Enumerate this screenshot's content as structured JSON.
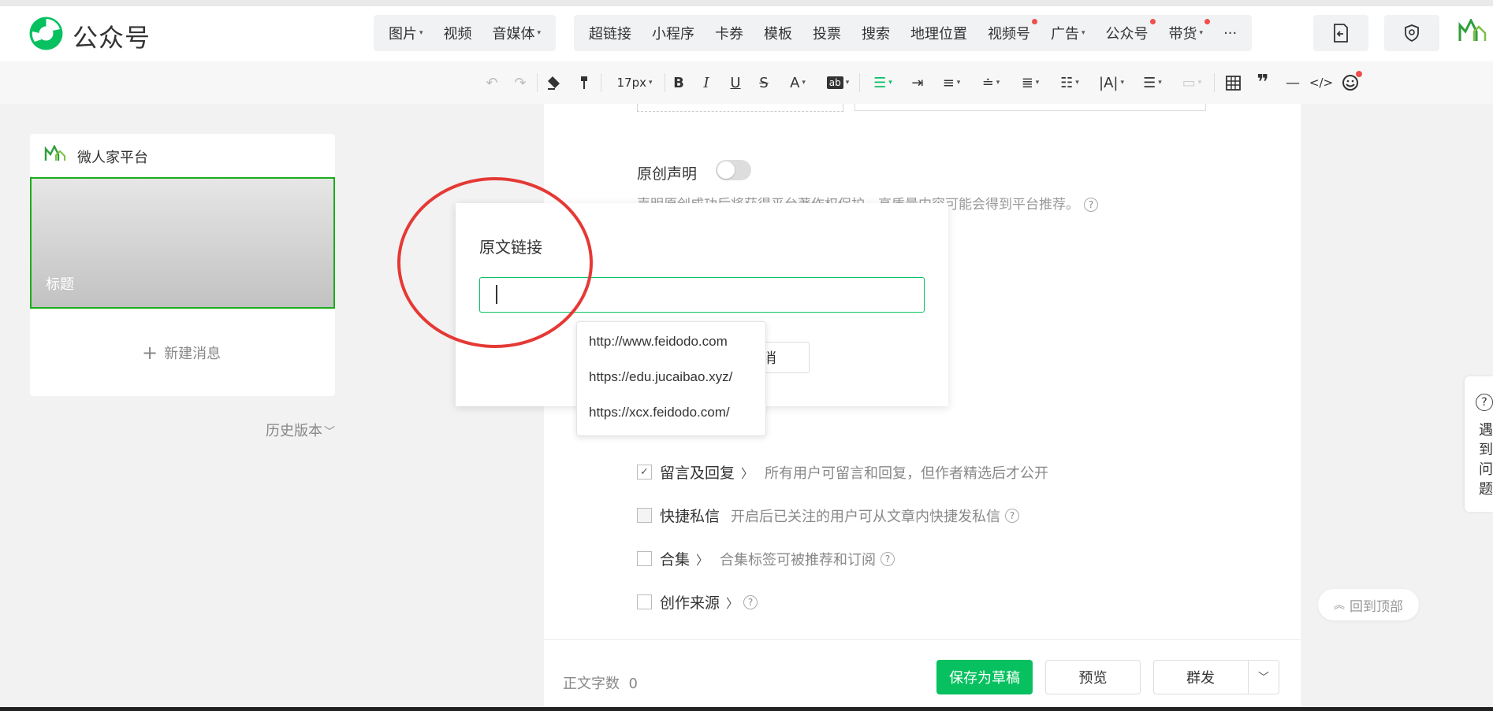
{
  "app": {
    "brand": "公众号"
  },
  "topnav": {
    "group1": [
      {
        "label": "图片",
        "caret": true
      },
      {
        "label": "视频",
        "caret": false
      },
      {
        "label": "音媒体",
        "caret": true
      }
    ],
    "group2": [
      {
        "label": "超链接",
        "caret": false,
        "dot": false
      },
      {
        "label": "小程序",
        "caret": false,
        "dot": false
      },
      {
        "label": "卡券",
        "caret": false,
        "dot": false
      },
      {
        "label": "模板",
        "caret": false,
        "dot": false
      },
      {
        "label": "投票",
        "caret": false,
        "dot": false
      },
      {
        "label": "搜索",
        "caret": false,
        "dot": false
      },
      {
        "label": "地理位置",
        "caret": false,
        "dot": false
      },
      {
        "label": "视频号",
        "caret": false,
        "dot": true
      },
      {
        "label": "广告",
        "caret": true,
        "dot": false
      },
      {
        "label": "公众号",
        "caret": false,
        "dot": true
      },
      {
        "label": "带货",
        "caret": true,
        "dot": true
      }
    ],
    "more": "···"
  },
  "toolbar": {
    "font_size": "17px"
  },
  "left": {
    "account_name": "微人家平台",
    "cover_title": "标题",
    "new_message": "新建消息",
    "history": "历史版本"
  },
  "editor": {
    "original_label": "原创声明",
    "original_desc": "声明原创成功后将获得平台著作权保护，高质量内容可能会得到平台推荐。",
    "rows": {
      "comments_label": "留言及回复",
      "comments_desc": "所有用户可留言和回复，但作者精选后才公开",
      "dm_label": "快捷私信",
      "dm_desc": "开启后已关注的用户可从文章内快捷发私信",
      "collection_label": "合集",
      "collection_desc": "合集标签可被推荐和订阅",
      "source_label": "创作来源"
    }
  },
  "bottom": {
    "word_count_label": "正文字数",
    "word_count": "0",
    "save_draft": "保存为草稿",
    "preview": "预览",
    "mass_send": "群发"
  },
  "right": {
    "help": "遇到问题",
    "back_to_top": "回到顶部"
  },
  "modal": {
    "title": "原文链接",
    "input_value": "",
    "cancel_partial": "消",
    "suggestions": [
      "http://www.feidodo.com",
      "https://edu.jucaibao.xyz/",
      "https://xcx.feidodo.com/"
    ]
  },
  "colors": {
    "accent_green": "#07c160",
    "annotation_red": "#e53935",
    "notify_dot": "#f14d4d"
  }
}
